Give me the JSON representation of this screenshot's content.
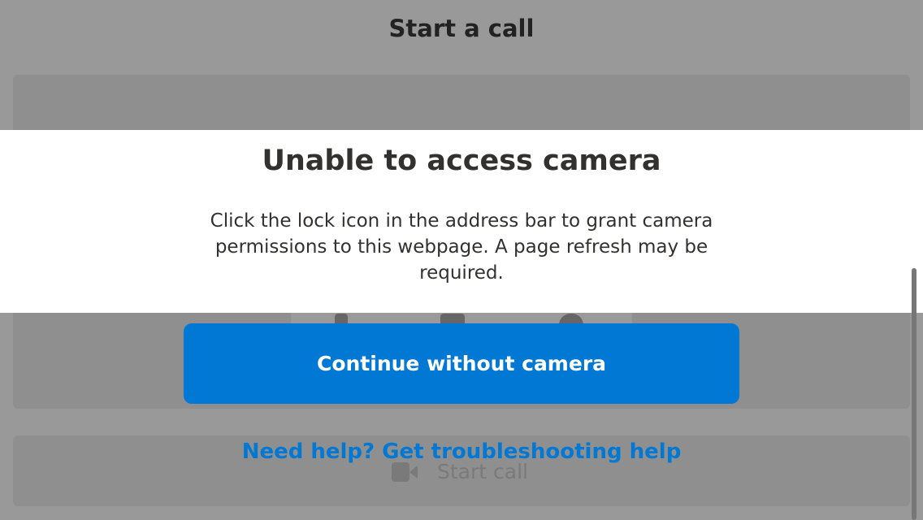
{
  "background": {
    "title": "Start a call",
    "start_call_label": "Start call"
  },
  "dialog": {
    "title": "Unable to access camera",
    "message": "Click the lock icon in the address bar to grant camera permissions to this webpage. A page refresh may be required.",
    "continue_label": "Continue without camera",
    "help_link": "Need help? Get troubleshooting help"
  },
  "colors": {
    "accent": "#0078d4"
  }
}
